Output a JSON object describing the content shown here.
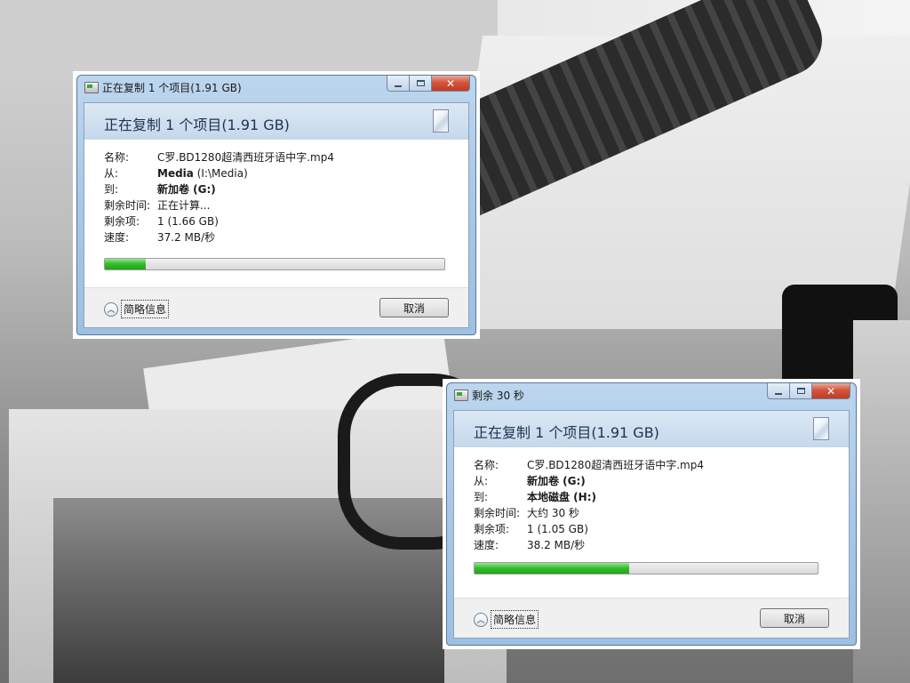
{
  "background": {
    "accent": "#1a1a1a"
  },
  "dialogs": [
    {
      "window_title": "正在复制 1 个项目(1.91 GB)",
      "heading": "正在复制 1 个项目(1.91 GB)",
      "fields": {
        "name_label": "名称:",
        "name_value": "C罗.BD1280超清西班牙语中字.mp4",
        "from_label": "从:",
        "from_value_bold": "Media",
        "from_value_rest": "(I:\\Media)",
        "to_label": "到:",
        "to_value": "新加卷 (G:)",
        "time_label": "剩余时间:",
        "time_value": "正在计算...",
        "items_label": "剩余项:",
        "items_value": "1 (1.66 GB)",
        "speed_label": "速度:",
        "speed_value": "37.2 MB/秒"
      },
      "progress_fraction": 0.12,
      "details_label": "简略信息",
      "cancel_label": "取消",
      "icons": [
        "copy-window-icon",
        "minimize-icon",
        "maximize-icon",
        "close-icon",
        "copy-animation-icon",
        "chevron-up-icon"
      ]
    },
    {
      "window_title": "剩余 30 秒",
      "heading": "正在复制 1 个项目(1.91 GB)",
      "fields": {
        "name_label": "名称:",
        "name_value": "C罗.BD1280超清西班牙语中字.mp4",
        "from_label": "从:",
        "from_value_bold": "新加卷 (G:)",
        "from_value_rest": "",
        "to_label": "到:",
        "to_value": "本地磁盘 (H:)",
        "time_label": "剩余时间:",
        "time_value": "大约 30 秒",
        "items_label": "剩余项:",
        "items_value": "1 (1.05 GB)",
        "speed_label": "速度:",
        "speed_value": "38.2 MB/秒"
      },
      "progress_fraction": 0.45,
      "details_label": "简略信息",
      "cancel_label": "取消",
      "icons": [
        "copy-window-icon",
        "minimize-icon",
        "maximize-icon",
        "close-icon",
        "copy-animation-icon",
        "chevron-up-icon"
      ]
    }
  ],
  "colors": {
    "progress_fill": "#36c02d",
    "close_button": "#c13b22",
    "header_band": "#c5d8ec",
    "window_frame": "#a9c7e6"
  }
}
